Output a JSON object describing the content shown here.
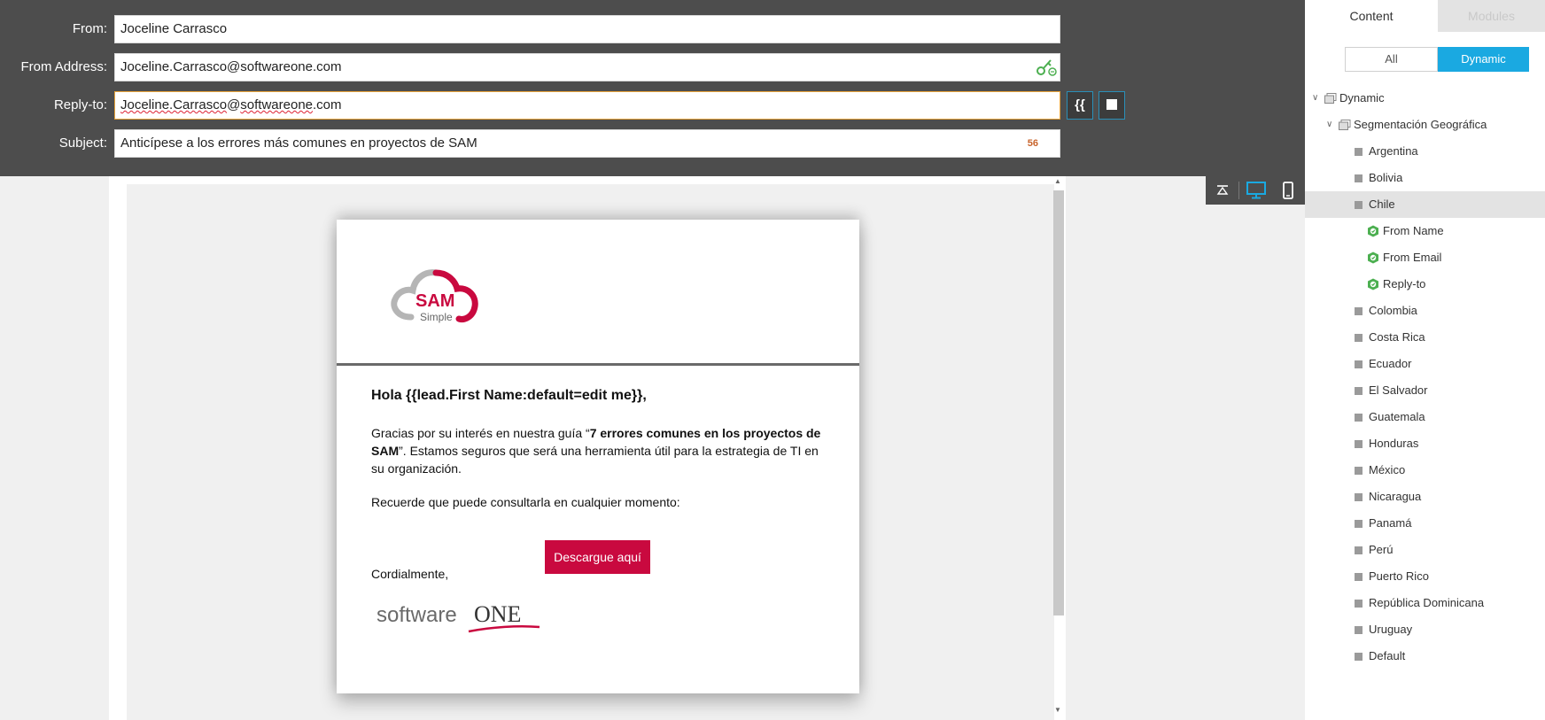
{
  "form": {
    "from_label": "From:",
    "from_value": "Joceline Carrasco",
    "from_address_label": "From Address:",
    "from_address_value": "Joceline.Carrasco@softwareone.com",
    "reply_to_label": "Reply-to:",
    "reply_to_value_a": "Joceline.Carrasco",
    "reply_to_value_b": "@",
    "reply_to_value_c": "softwareone",
    "reply_to_value_d": ".com",
    "subject_label": "Subject:",
    "subject_value": "Anticípese a los errores más comunes en proyectos de SAM",
    "subject_counter": "56",
    "token_button_label": "{{"
  },
  "email": {
    "logo_text_main": "SAM",
    "logo_text_sub": "Simple",
    "greeting": "Hola {{lead.First Name:default=edit me}},",
    "para_part1": "Gracias por su interés en nuestra guía “",
    "para_bold1": "7 errores comunes en los proyectos de SAM",
    "para_part2": "”. Estamos seguros que será una herramienta útil para la estrategia de TI en su organización.",
    "para2": "Recuerde que puede consultarla en cualquier momento:",
    "cta_label": "Descargue aquí",
    "closing": "Cordialmente,",
    "brand_logo_text_a": "software",
    "brand_logo_text_b": "ONE"
  },
  "panel": {
    "tab_content": "Content",
    "tab_modules": "Modules",
    "filter_all": "All",
    "filter_dynamic": "Dynamic",
    "tree": {
      "root": "Dynamic",
      "group": "Segmentación Geográfica",
      "countries_before": [
        "Argentina",
        "Bolivia"
      ],
      "selected": "Chile",
      "selected_children": [
        "From Name",
        "From Email",
        "Reply-to"
      ],
      "countries_after": [
        "Colombia",
        "Costa Rica",
        "Ecuador",
        "El Salvador",
        "Guatemala",
        "Honduras",
        "México",
        "Nicaragua",
        "Panamá",
        "Perú",
        "Puerto Rico",
        "República Dominicana",
        "Uruguay",
        "Default"
      ]
    }
  },
  "colors": {
    "header_bg": "#4d4d4d",
    "accent_blue": "#1aa9e1",
    "cta_red": "#c9093f",
    "logo_red": "#c9093f",
    "logo_gray": "#b5b5b5",
    "focus_orange": "#e8a33a"
  },
  "icons": {
    "key": "key-icon",
    "token": "token-icon",
    "stop": "stop-icon",
    "collapse": "collapse-top-icon",
    "desktop": "desktop-icon",
    "mobile": "mobile-icon",
    "folder": "folder-icon",
    "item": "square-icon",
    "variable": "gear-icon"
  }
}
